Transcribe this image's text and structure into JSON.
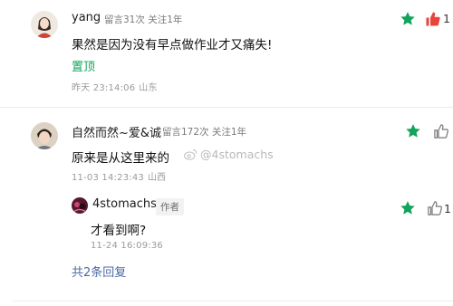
{
  "comments": [
    {
      "username": "yang",
      "stats": "留言31次 关注1年",
      "text": "果然是因为没有早点做作业才又痛失!",
      "pin_label": "置顶",
      "time": "昨天 23:14:06",
      "location": "山东",
      "like_count": "1",
      "liked": true
    },
    {
      "username": "自然而然~爱&诚",
      "stats": "留言172次 关注1年",
      "text": "原来是从这里来的",
      "time": "11-03 14:23:43",
      "location": "山西",
      "like_count": "",
      "liked": false,
      "reply": {
        "username": "4stomachs",
        "author_tag": "作者",
        "text": "才看到啊?",
        "time": "11-24 16:09:36",
        "like_count": "1"
      },
      "more_replies": "共2条回复"
    }
  ],
  "watermark": "@4stomachs",
  "colors": {
    "accent_green": "#12a35c",
    "like_red": "#e8443a",
    "muted": "#9a9a9a"
  }
}
